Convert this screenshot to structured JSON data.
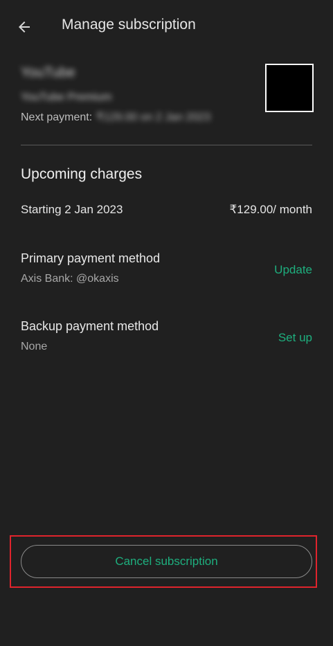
{
  "header": {
    "title": "Manage subscription",
    "back_icon": "arrow-left-icon"
  },
  "subscription": {
    "app_name": "YouTube",
    "plan_name": "YouTube Premium",
    "next_payment_label": "Next payment:",
    "next_payment_value": "₹129.00 on 2 Jan 2023"
  },
  "upcoming": {
    "heading": "Upcoming charges",
    "start_label": "Starting 2 Jan 2023",
    "price": "₹129.00/ month"
  },
  "primary_payment": {
    "title": "Primary payment method",
    "value": "Axis Bank: @okaxis",
    "action": "Update"
  },
  "backup_payment": {
    "title": "Backup payment method",
    "value": "None",
    "action": "Set up"
  },
  "footer": {
    "cancel_label": "Cancel subscription"
  },
  "colors": {
    "background": "#202020",
    "accent": "#1eaf7e",
    "highlight": "#e0242c"
  }
}
